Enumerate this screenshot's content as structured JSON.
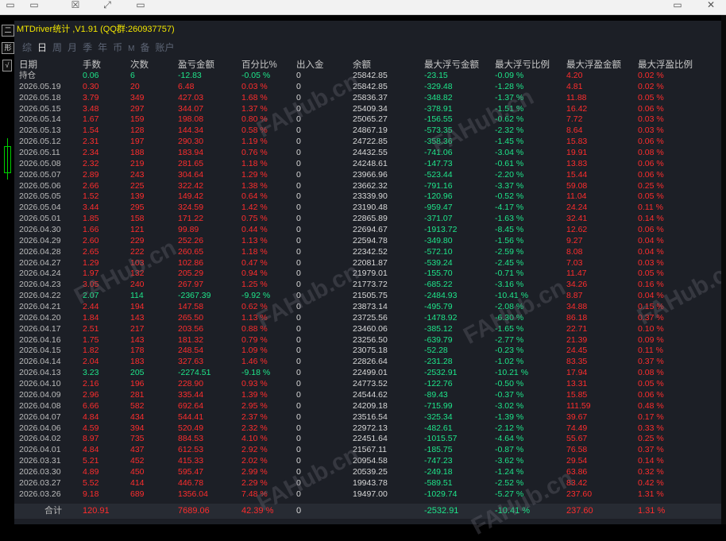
{
  "window": {
    "title": "MTDriver统计 ,V1.91 (QQ群:260937757)"
  },
  "left_strip": {
    "btn1": "二",
    "btn2": "形",
    "btn3": "√"
  },
  "tabs": [
    {
      "label": "综",
      "active": false,
      "small": false
    },
    {
      "label": "日",
      "active": true,
      "small": false
    },
    {
      "label": "周",
      "active": false,
      "small": false
    },
    {
      "label": "月",
      "active": false,
      "small": false
    },
    {
      "label": "季",
      "active": false,
      "small": false
    },
    {
      "label": "年",
      "active": false,
      "small": false
    },
    {
      "label": "币",
      "active": false,
      "small": false
    },
    {
      "label": "M",
      "active": false,
      "small": true
    },
    {
      "label": "备",
      "active": false,
      "small": false
    },
    {
      "label": "账户",
      "active": false,
      "small": false
    }
  ],
  "columns": [
    "日期",
    "手数",
    "次数",
    "盈亏金额",
    "百分比%",
    "出入金",
    "余额",
    "最大浮亏金额",
    "最大浮亏比例",
    "最大浮盈金额",
    "最大浮盈比例"
  ],
  "rows": [
    [
      "持仓",
      "0.06",
      "6",
      "-12.83",
      "-0.05 %",
      "0",
      "25842.85",
      "-23.15",
      "-0.09 %",
      "4.20",
      "0.02 %"
    ],
    [
      "2026.05.19",
      "0.30",
      "20",
      "6.48",
      "0.03 %",
      "0",
      "25842.85",
      "-329.48",
      "-1.28 %",
      "4.81",
      "0.02 %"
    ],
    [
      "2026.05.18",
      "3.79",
      "349",
      "427.03",
      "1.68 %",
      "0",
      "25836.37",
      "-348.82",
      "-1.37 %",
      "11.88",
      "0.05 %"
    ],
    [
      "2026.05.15",
      "3.48",
      "297",
      "344.07",
      "1.37 %",
      "0",
      "25409.34",
      "-378.91",
      "-1.51 %",
      "16.42",
      "0.06 %"
    ],
    [
      "2026.05.14",
      "1.67",
      "159",
      "198.08",
      "0.80 %",
      "0",
      "25065.27",
      "-156.55",
      "-0.62 %",
      "7.72",
      "0.03 %"
    ],
    [
      "2026.05.13",
      "1.54",
      "128",
      "144.34",
      "0.58 %",
      "0",
      "24867.19",
      "-573.35",
      "-2.32 %",
      "8.64",
      "0.03 %"
    ],
    [
      "2026.05.12",
      "2.31",
      "197",
      "290.30",
      "1.19 %",
      "0",
      "24722.85",
      "-358.36",
      "-1.45 %",
      "15.83",
      "0.06 %"
    ],
    [
      "2026.05.11",
      "2.34",
      "188",
      "183.94",
      "0.76 %",
      "0",
      "24432.55",
      "-741.06",
      "-3.04 %",
      "19.91",
      "0.08 %"
    ],
    [
      "2026.05.08",
      "2.32",
      "219",
      "281.65",
      "1.18 %",
      "0",
      "24248.61",
      "-147.73",
      "-0.61 %",
      "13.83",
      "0.06 %"
    ],
    [
      "2026.05.07",
      "2.89",
      "243",
      "304.64",
      "1.29 %",
      "0",
      "23966.96",
      "-523.44",
      "-2.20 %",
      "15.44",
      "0.06 %"
    ],
    [
      "2026.05.06",
      "2.66",
      "225",
      "322.42",
      "1.38 %",
      "0",
      "23662.32",
      "-791.16",
      "-3.37 %",
      "59.08",
      "0.25 %"
    ],
    [
      "2026.05.05",
      "1.52",
      "139",
      "149.42",
      "0.64 %",
      "0",
      "23339.90",
      "-120.96",
      "-0.52 %",
      "11.04",
      "0.05 %"
    ],
    [
      "2026.05.04",
      "3.44",
      "295",
      "324.59",
      "1.42 %",
      "0",
      "23190.48",
      "-959.47",
      "-4.17 %",
      "24.24",
      "0.11 %"
    ],
    [
      "2026.05.01",
      "1.85",
      "158",
      "171.22",
      "0.75 %",
      "0",
      "22865.89",
      "-371.07",
      "-1.63 %",
      "32.41",
      "0.14 %"
    ],
    [
      "2026.04.30",
      "1.66",
      "121",
      "99.89",
      "0.44 %",
      "0",
      "22694.67",
      "-1913.72",
      "-8.45 %",
      "12.62",
      "0.06 %"
    ],
    [
      "2026.04.29",
      "2.60",
      "229",
      "252.26",
      "1.13 %",
      "0",
      "22594.78",
      "-349.80",
      "-1.56 %",
      "9.27",
      "0.04 %"
    ],
    [
      "2026.04.28",
      "2.65",
      "222",
      "260.65",
      "1.18 %",
      "0",
      "22342.52",
      "-572.10",
      "-2.59 %",
      "8.08",
      "0.04 %"
    ],
    [
      "2026.04.27",
      "1.29",
      "103",
      "102.86",
      "0.47 %",
      "0",
      "22081.87",
      "-539.24",
      "-2.45 %",
      "7.03",
      "0.03 %"
    ],
    [
      "2026.04.24",
      "1.97",
      "132",
      "205.29",
      "0.94 %",
      "0",
      "21979.01",
      "-155.70",
      "-0.71 %",
      "11.47",
      "0.05 %"
    ],
    [
      "2026.04.23",
      "3.05",
      "240",
      "267.97",
      "1.25 %",
      "0",
      "21773.72",
      "-685.22",
      "-3.16 %",
      "34.26",
      "0.16 %"
    ],
    [
      "2026.04.22",
      "2.07",
      "114",
      "-2367.39",
      "-9.92 %",
      "0",
      "21505.75",
      "-2484.93",
      "-10.41 %",
      "8.87",
      "0.04 %"
    ],
    [
      "2026.04.21",
      "2.44",
      "194",
      "147.58",
      "0.62 %",
      "0",
      "23873.14",
      "-495.79",
      "-2.08 %",
      "34.88",
      "0.15 %"
    ],
    [
      "2026.04.20",
      "1.84",
      "143",
      "265.50",
      "1.13 %",
      "0",
      "23725.56",
      "-1478.92",
      "-6.30 %",
      "86.18",
      "0.37 %"
    ],
    [
      "2026.04.17",
      "2.51",
      "217",
      "203.56",
      "0.88 %",
      "0",
      "23460.06",
      "-385.12",
      "-1.65 %",
      "22.71",
      "0.10 %"
    ],
    [
      "2026.04.16",
      "1.75",
      "143",
      "181.32",
      "0.79 %",
      "0",
      "23256.50",
      "-639.79",
      "-2.77 %",
      "21.39",
      "0.09 %"
    ],
    [
      "2026.04.15",
      "1.82",
      "178",
      "248.54",
      "1.09 %",
      "0",
      "23075.18",
      "-52.28",
      "-0.23 %",
      "24.45",
      "0.11 %"
    ],
    [
      "2026.04.14",
      "2.04",
      "183",
      "327.63",
      "1.46 %",
      "0",
      "22826.64",
      "-231.28",
      "-1.02 %",
      "83.35",
      "0.37 %"
    ],
    [
      "2026.04.13",
      "3.23",
      "205",
      "-2274.51",
      "-9.18 %",
      "0",
      "22499.01",
      "-2532.91",
      "-10.21 %",
      "17.94",
      "0.08 %"
    ],
    [
      "2026.04.10",
      "2.16",
      "196",
      "228.90",
      "0.93 %",
      "0",
      "24773.52",
      "-122.76",
      "-0.50 %",
      "13.31",
      "0.05 %"
    ],
    [
      "2026.04.09",
      "2.96",
      "281",
      "335.44",
      "1.39 %",
      "0",
      "24544.62",
      "-89.43",
      "-0.37 %",
      "15.85",
      "0.06 %"
    ],
    [
      "2026.04.08",
      "6.66",
      "582",
      "692.64",
      "2.95 %",
      "0",
      "24209.18",
      "-715.99",
      "-3.02 %",
      "111.59",
      "0.48 %"
    ],
    [
      "2026.04.07",
      "4.84",
      "434",
      "544.41",
      "2.37 %",
      "0",
      "23516.54",
      "-325.34",
      "-1.39 %",
      "39.67",
      "0.17 %"
    ],
    [
      "2026.04.06",
      "4.59",
      "394",
      "520.49",
      "2.32 %",
      "0",
      "22972.13",
      "-482.61",
      "-2.12 %",
      "74.49",
      "0.33 %"
    ],
    [
      "2026.04.02",
      "8.97",
      "735",
      "884.53",
      "4.10 %",
      "0",
      "22451.64",
      "-1015.57",
      "-4.64 %",
      "55.67",
      "0.25 %"
    ],
    [
      "2026.04.01",
      "4.84",
      "437",
      "612.53",
      "2.92 %",
      "0",
      "21567.11",
      "-185.75",
      "-0.87 %",
      "76.58",
      "0.37 %"
    ],
    [
      "2026.03.31",
      "5.21",
      "452",
      "415.33",
      "2.02 %",
      "0",
      "20954.58",
      "-747.23",
      "-3.62 %",
      "29.54",
      "0.14 %"
    ],
    [
      "2026.03.30",
      "4.89",
      "450",
      "595.47",
      "2.99 %",
      "0",
      "20539.25",
      "-249.18",
      "-1.24 %",
      "63.86",
      "0.32 %"
    ],
    [
      "2026.03.27",
      "5.52",
      "414",
      "446.78",
      "2.29 %",
      "0",
      "19943.78",
      "-589.51",
      "-2.52 %",
      "83.42",
      "0.42 %"
    ],
    [
      "2026.03.26",
      "9.18",
      "689",
      "1356.04",
      "7.48 %",
      "0",
      "19497.00",
      "-1029.74",
      "-5.27 %",
      "237.60",
      "1.31 %"
    ]
  ],
  "total": [
    "合计",
    "120.91",
    "",
    "7689.06",
    "42.39 %",
    "0",
    "",
    "-2532.91",
    "-10.41 %",
    "237.60",
    "1.31 %"
  ],
  "colors": {
    "positive": "#ff2d2d",
    "negative": "#1ee58a",
    "title": "#f2e600",
    "panel": "#1c1f26"
  }
}
